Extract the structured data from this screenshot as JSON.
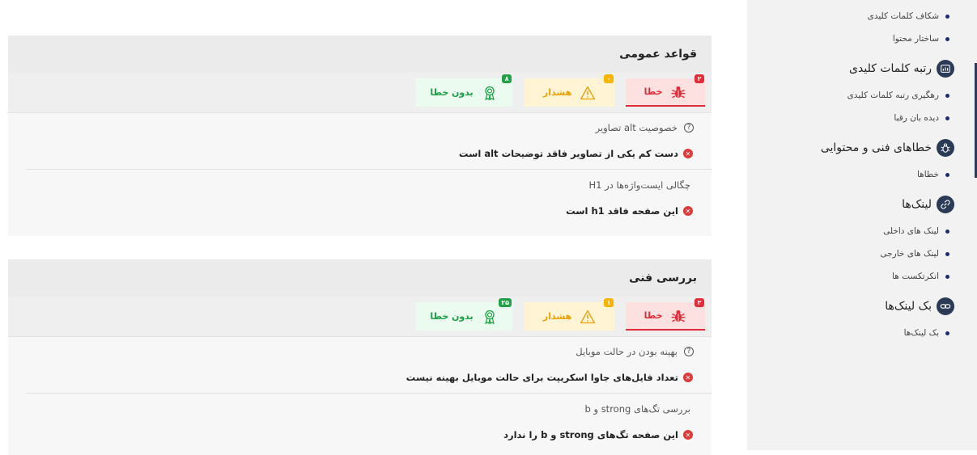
{
  "sidebar": {
    "top_items": [
      {
        "label": "شکاف کلمات کلیدی"
      },
      {
        "label": "ساختار محتوا"
      }
    ],
    "groups": [
      {
        "title": "رتبه کلمات کلیدی",
        "icon": "chart-icon",
        "items": [
          {
            "label": "رهگیری رتبه کلمات کلیدی"
          },
          {
            "label": "دیده بان رقبا"
          }
        ]
      },
      {
        "title": "خطاهای فنی و محتوایی",
        "icon": "bug-icon",
        "items": [
          {
            "label": "خطاها"
          }
        ]
      },
      {
        "title": "لینک‌ها",
        "icon": "link-icon",
        "items": [
          {
            "label": "لینک های داخلی"
          },
          {
            "label": "لینک های خارجی"
          },
          {
            "label": "انکرتکست ها"
          }
        ]
      },
      {
        "title": "بک لینک‌ها",
        "icon": "chain-icon",
        "items": [
          {
            "label": "بک لینک‌ها"
          }
        ]
      }
    ]
  },
  "cards": [
    {
      "title": "قواعد عمومی",
      "tabs": {
        "error": {
          "label": "خطا",
          "count": "۲"
        },
        "warning": {
          "label": "هشدار",
          "count": "۰"
        },
        "ok": {
          "label": "بدون خطا",
          "count": "۸"
        }
      },
      "rules": [
        {
          "title": "خصوصیت alt تصاویر",
          "result": "دست کم یکی از تصاویر فاقد توضیحات alt است",
          "has_help": true
        },
        {
          "title": "چگالی ایست‌واژه‌ها در H1",
          "result": "این صفحه فاقد h1 است",
          "has_help": false
        }
      ]
    },
    {
      "title": "بررسی فنی",
      "tabs": {
        "error": {
          "label": "خطا",
          "count": "۲"
        },
        "warning": {
          "label": "هشدار",
          "count": "۱"
        },
        "ok": {
          "label": "بدون خطا",
          "count": "۲۵"
        }
      },
      "rules": [
        {
          "title": "بهینه بودن در حالت موبایل",
          "result": "تعداد فایل‌های جاوا اسکریپت برای حالت موبایل بهینه نیست",
          "has_help": true
        },
        {
          "title": "بررسی تگ‌های strong و b",
          "result": "این صفحه تگ‌های strong و b را ندارد",
          "has_help": false
        }
      ]
    }
  ],
  "colors": {
    "error": "#e12d39",
    "warning": "#f7b500",
    "ok": "#23a048",
    "sidebar_icon_bg": "#2b3a55",
    "bullet": "#1c2a6e"
  }
}
